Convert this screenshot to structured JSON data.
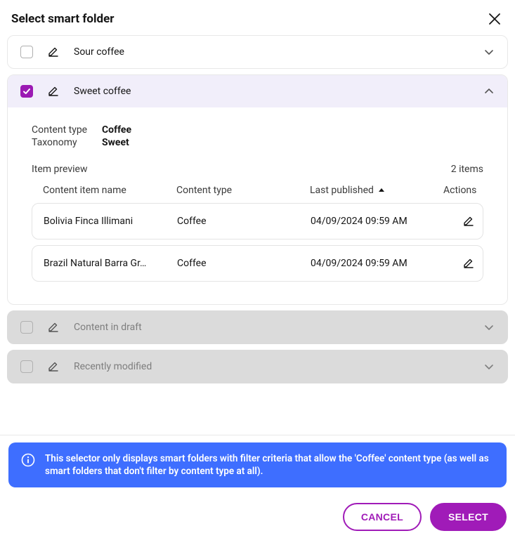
{
  "header": {
    "title": "Select smart folder"
  },
  "folders": [
    {
      "label": "Sour coffee"
    },
    {
      "label": "Sweet coffee"
    },
    {
      "label": "Content in draft"
    },
    {
      "label": "Recently modified"
    }
  ],
  "details": {
    "content_type_label": "Content type",
    "content_type_value": "Coffee",
    "taxonomy_label": "Taxonomy",
    "taxonomy_value": "Sweet",
    "preview_label": "Item preview",
    "items_count": "2 items",
    "columns": {
      "name": "Content item name",
      "type": "Content type",
      "published": "Last published",
      "actions": "Actions"
    },
    "rows": [
      {
        "name": "Bolivia Finca Illimani",
        "type": "Coffee",
        "published": "04/09/2024 09:59 AM"
      },
      {
        "name": "Brazil Natural Barra Gr…",
        "type": "Coffee",
        "published": "04/09/2024 09:59 AM"
      }
    ]
  },
  "banner": {
    "text": "This selector only displays smart folders with filter criteria that allow the 'Coffee' content type (as well as smart folders that don't filter by content type at all)."
  },
  "buttons": {
    "cancel": "CANCEL",
    "select": "SELECT"
  }
}
